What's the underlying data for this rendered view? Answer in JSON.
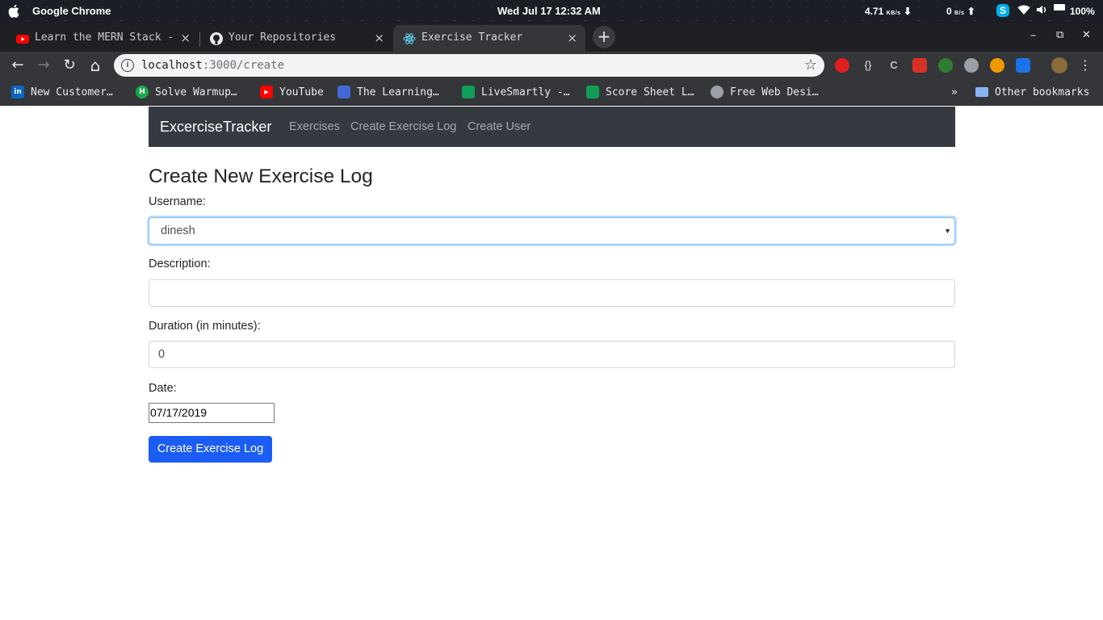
{
  "os": {
    "app_name": "Google Chrome",
    "clock": "Wed Jul 17  12:32 AM",
    "net_down_value": "4.71",
    "net_down_unit": "KB/s",
    "net_up_value": "0",
    "net_up_unit": "B/s",
    "battery": "100%"
  },
  "tabs": [
    {
      "title": "Learn the MERN Stack - ",
      "close": "×"
    },
    {
      "title": "Your Repositories",
      "close": "×"
    },
    {
      "title": "Exercise Tracker",
      "close": "×"
    }
  ],
  "new_tab": "+",
  "window_controls": {
    "minimize": "–",
    "restore": "⧉",
    "close": "✕"
  },
  "toolbar": {
    "back": "←",
    "forward": "→",
    "reload": "↻",
    "home": "⌂",
    "url_host": "localhost",
    "url_path": ":3000/create",
    "info": "i",
    "star": "☆"
  },
  "bookmarks": [
    {
      "label": "New Customer…",
      "icon": "in"
    },
    {
      "label": "Solve Warmup…",
      "icon": "H"
    },
    {
      "label": "YouTube",
      "icon": "▶"
    },
    {
      "label": "The Learning…",
      "icon": ""
    },
    {
      "label": "LiveSmartly -…",
      "icon": ""
    },
    {
      "label": "Score Sheet L…",
      "icon": ""
    },
    {
      "label": "Free Web Desi…",
      "icon": ""
    }
  ],
  "bookmarks_overflow": "»",
  "other_bookmarks": "Other bookmarks",
  "app": {
    "brand": "ExcerciseTracker",
    "nav": [
      "Exercises",
      "Create Exercise Log",
      "Create User"
    ],
    "heading": "Create New Exercise Log",
    "username_label": "Username:",
    "username_value": "dinesh",
    "description_label": "Description:",
    "description_value": "",
    "duration_label": "Duration (in minutes):",
    "duration_value": "0",
    "date_label": "Date:",
    "date_value": "07/17/2019",
    "submit_label": "Create Exercise Log"
  }
}
